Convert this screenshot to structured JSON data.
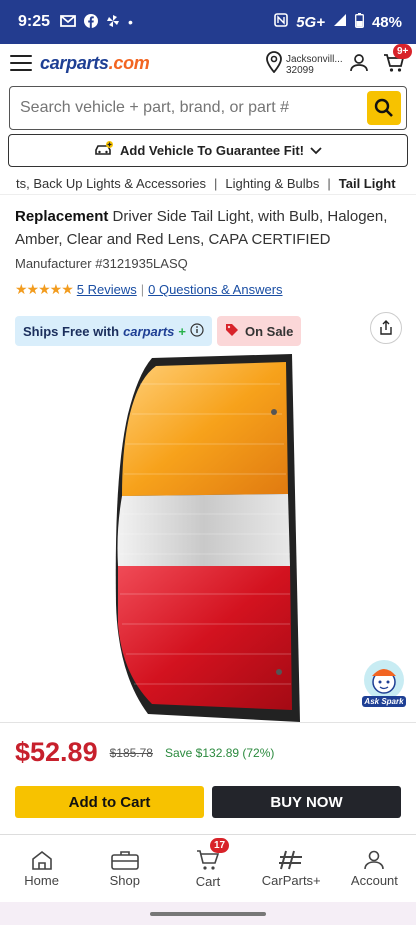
{
  "status": {
    "time": "9:25",
    "network": "5G+",
    "battery": "48%"
  },
  "header": {
    "logo": "carparts",
    "logo_suffix": ".com",
    "location": [
      "Jacksonvill...",
      "32099"
    ],
    "cart_badge": "9+"
  },
  "search": {
    "placeholder": "Search vehicle + part, brand, or part #"
  },
  "add_vehicle": {
    "label": "Add Vehicle To Guarantee Fit!"
  },
  "breadcrumbs": [
    "ts, Back Up Lights & Accessories",
    "Lighting & Bulbs",
    "Tail Light"
  ],
  "product": {
    "title_bold": "Replacement",
    "title_rest": " Driver Side Tail Light, with Bulb, Halogen, Amber, Clear and Red Lens, CAPA CERTIFIED",
    "manufacturer": "Manufacturer #3121935LASQ",
    "rating": 5,
    "reviews_link": "5 Reviews",
    "qa_link": "0 Questions & Answers"
  },
  "badges": {
    "ships_free": "Ships Free with",
    "ships_brand": "carparts",
    "on_sale": "On Sale"
  },
  "spark": {
    "label": "Ask Spark"
  },
  "pricing": {
    "price": "$52.89",
    "original": "$185.78",
    "save": "Save $132.89 (72%)"
  },
  "actions": {
    "add_to_cart": "Add to Cart",
    "buy_now": "BUY NOW"
  },
  "nav": {
    "home": "Home",
    "shop": "Shop",
    "cart": "Cart",
    "cart_badge": "17",
    "carparts_plus": "CarParts+",
    "account": "Account"
  },
  "colors": {
    "brand": "#1e3f94",
    "accent_yellow": "#f7c200",
    "price_red": "#c7202c",
    "statusbar": "#233c8f"
  }
}
